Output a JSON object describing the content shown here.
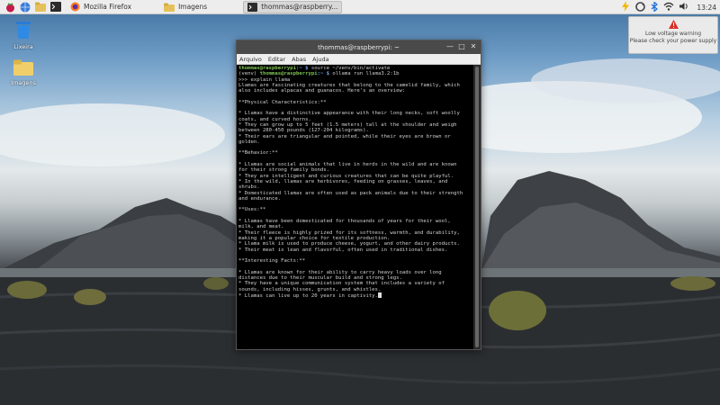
{
  "taskbar": {
    "tasks": [
      {
        "label": "Mozilla Firefox",
        "icon": "firefox-icon",
        "active": false
      },
      {
        "label": "Imagens",
        "icon": "folder-icon",
        "active": false
      },
      {
        "label": "thommas@raspberry...",
        "icon": "terminal-icon",
        "active": true
      }
    ],
    "clock": "13:24"
  },
  "desktop": {
    "icons": [
      {
        "label": "Lixeira",
        "icon": "trash-icon"
      },
      {
        "label": "Imagens",
        "icon": "folder-icon"
      }
    ]
  },
  "notification": {
    "title": "Low voltage warning",
    "message": "Please check your power supply",
    "icon": "warning-icon",
    "accent": "#d93025"
  },
  "terminal": {
    "title": "thommas@raspberrypi: ~",
    "menu": [
      "Arquivo",
      "Editar",
      "Abas",
      "Ajuda"
    ],
    "line1_user": "thommas@raspberrypi",
    "line1_path": ":~ $",
    "line1_cmd": " source ~/venv/bin/activate",
    "line2_venv": "(venv) ",
    "line2_user": "thommas@raspberrypi",
    "line2_path": ":~ $",
    "line2_cmd": " ollama run llama3.2:1b",
    "output": ">>> explain llama\nLlamas are fascinating creatures that belong to the camelid family, which\nalso includes alpacas and guanacos. Here's an overview:\n\n**Physical Characteristics:**\n\n* Llamas have a distinctive appearance with their long necks, soft woolly\ncoats, and curved horns.\n* They can grow up to 5 feet (1.5 meters) tall at the shoulder and weigh\nbetween 280-450 pounds (127-204 kilograms).\n* Their ears are triangular and pointed, while their eyes are brown or\ngolden.\n\n**Behavior:**\n\n* Llamas are social animals that live in herds in the wild and are known\nfor their strong family bonds.\n* They are intelligent and curious creatures that can be quite playful.\n* In the wild, llamas are herbivores, feeding on grasses, leaves, and\nshrubs.\n* Domesticated llamas are often used as pack animals due to their strength\nand endurance.\n\n**Uses:**\n\n* Llamas have been domesticated for thousands of years for their wool,\nmilk, and meat.\n* Their fleece is highly prized for its softness, warmth, and durability,\nmaking it a popular choice for textile production.\n* Llama milk is used to produce cheese, yogurt, and other dairy products.\n* Their meat is lean and flavorful, often used in traditional dishes.\n\n**Interesting Facts:**\n\n* Llamas are known for their ability to carry heavy loads over long\ndistances due to their muscular build and strong legs.\n* They have a unique communication system that includes a variety of\nsounds, including hisses, grunts, and whistles.\n* Llamas can live up to 20 years in captivity."
  }
}
